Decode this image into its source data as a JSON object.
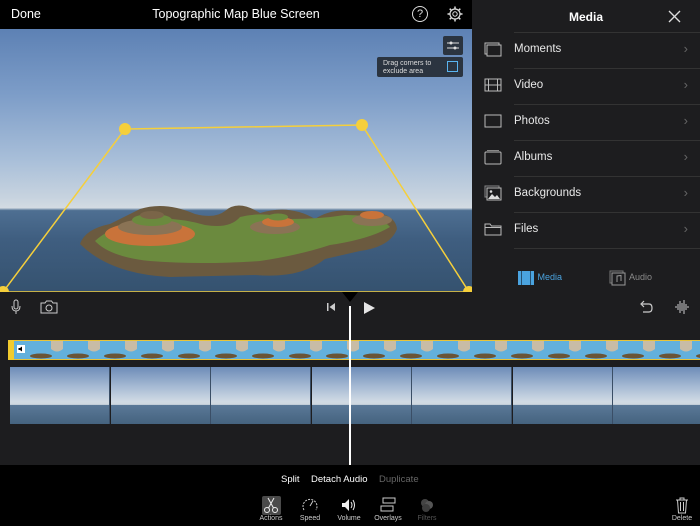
{
  "topbar": {
    "done_label": "Done",
    "title": "Topographic Map Blue Screen",
    "help_icon_glyph": "?"
  },
  "viewer": {
    "hint_text_line1": "Drag corners to",
    "hint_text_line2": "exclude area",
    "accent_color": "#f5cf3b"
  },
  "media_panel": {
    "title": "Media",
    "items": [
      {
        "label": "Moments",
        "icon": "moments-icon"
      },
      {
        "label": "Video",
        "icon": "film-icon"
      },
      {
        "label": "Photos",
        "icon": "photos-icon"
      },
      {
        "label": "Albums",
        "icon": "albums-icon"
      },
      {
        "label": "Backgrounds",
        "icon": "backgrounds-icon"
      },
      {
        "label": "Files",
        "icon": "folder-icon"
      }
    ],
    "tabs": [
      {
        "label": "Media",
        "active": true,
        "color": "#4aa3df"
      },
      {
        "label": "Audio",
        "active": false,
        "color": "#8a8a8a"
      }
    ]
  },
  "actions_bar": {
    "split": "Split",
    "detach_audio": "Detach Audio",
    "duplicate": "Duplicate",
    "tools": [
      {
        "label": "Actions",
        "selected": true
      },
      {
        "label": "Speed"
      },
      {
        "label": "Volume"
      },
      {
        "label": "Overlays"
      },
      {
        "label": "Filters",
        "disabled": true
      }
    ],
    "delete": "Delete"
  }
}
